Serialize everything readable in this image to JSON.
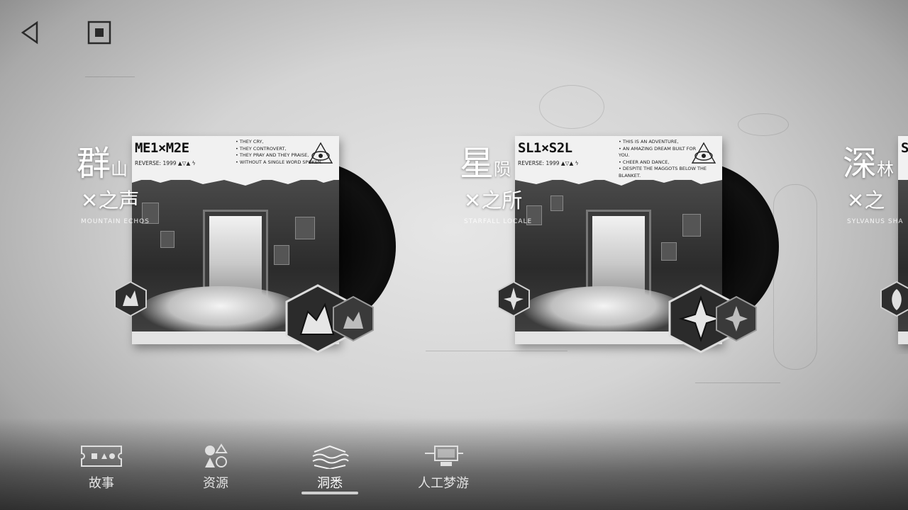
{
  "topbar": {
    "back_icon": "triangle-left-icon",
    "home_icon": "square-stop-icon"
  },
  "cards": [
    {
      "title_main": "群",
      "title_sub": "山",
      "title_line2": "之声",
      "title_en": "MOUNTAIN ECHOS",
      "code": "ME1×M2E",
      "reverse": "REVERSE: 1999 ▲▽▲ ϟ",
      "poem": [
        "THEY CRY,",
        "THEY CONTROVERT,",
        "THEY PRAY AND THEY PRAISE,",
        "WITHOUT A SINGLE WORD SPOKEN."
      ],
      "badge_icon": "mountain-icon"
    },
    {
      "title_main": "星",
      "title_sub": "陨",
      "title_line2": "之所",
      "title_en": "STARFALL LOCALE",
      "code": "SL1×S2L",
      "reverse": "REVERSE: 1999 ▲▽▲ ϟ",
      "poem": [
        "THIS IS AN ADVENTURE,",
        "AN AMAZING DREAM BUILT FOR YOU.",
        "CHEER AND DANCE,",
        "DESPITE THE MAGGOTS BELOW THE BLANKET."
      ],
      "badge_icon": "star-shard-icon"
    },
    {
      "title_main": "深",
      "title_sub": "林",
      "title_line2": "之",
      "title_en": "SYLVANUS SHA",
      "code": "S",
      "badge_icon": "leaf-icon"
    }
  ],
  "nav": [
    {
      "label": "故事",
      "icon": "ticket-icon"
    },
    {
      "label": "资源",
      "icon": "shapes-icon"
    },
    {
      "label": "洞悉",
      "icon": "waves-insight-icon",
      "active": true
    },
    {
      "label": "人工梦游",
      "icon": "computer-dream-icon"
    }
  ]
}
